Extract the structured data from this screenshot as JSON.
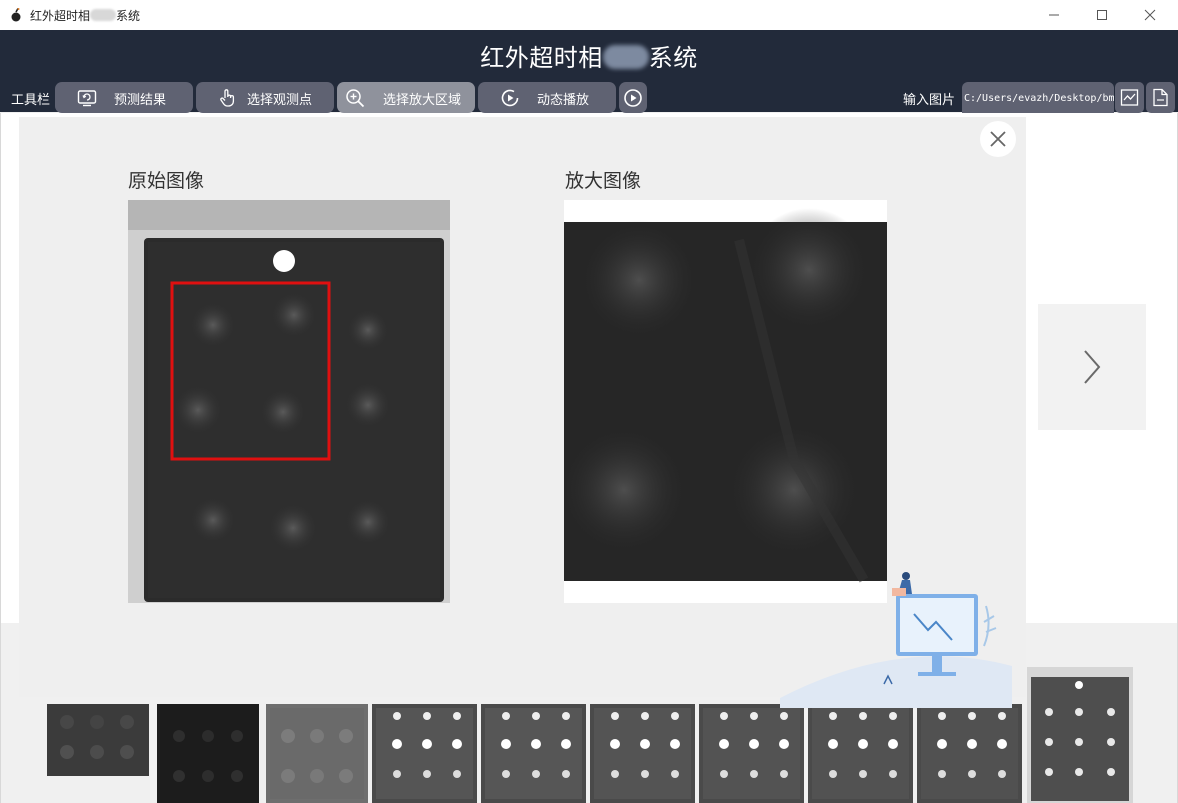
{
  "window": {
    "title_prefix": "红外超时相",
    "title_suffix": "系统",
    "controls": [
      "minimize",
      "maximize",
      "close"
    ]
  },
  "header": {
    "title_prefix": "红外超时相",
    "title_suffix": "系统"
  },
  "toolbar": {
    "label": "工具栏",
    "buttons": [
      {
        "label": "预测结果",
        "icon": "screen-refresh-icon",
        "active": false
      },
      {
        "label": "选择观测点",
        "icon": "hand-pointer-icon",
        "active": false
      },
      {
        "label": "选择放大区域",
        "icon": "zoom-in-icon",
        "active": true
      },
      {
        "label": "动态播放",
        "icon": "play-circle-icon",
        "active": false
      }
    ],
    "extra_icon": "play-circle-icon",
    "input_label": "输入图片",
    "input_value": "C:/Users/evazh/Desktop/bmp",
    "chart_icon": "chart-icon",
    "folder_icon": "file-icon"
  },
  "popup": {
    "original_title": "原始图像",
    "zoom_title": "放大图像",
    "close_icon": "close-icon"
  },
  "nav": {
    "next_icon": "chevron-right-icon"
  },
  "colors": {
    "header_bg": "#222a3a",
    "button_bg": "#5f6272",
    "button_active_bg": "#8f929c",
    "selection_box": "#e01010"
  }
}
